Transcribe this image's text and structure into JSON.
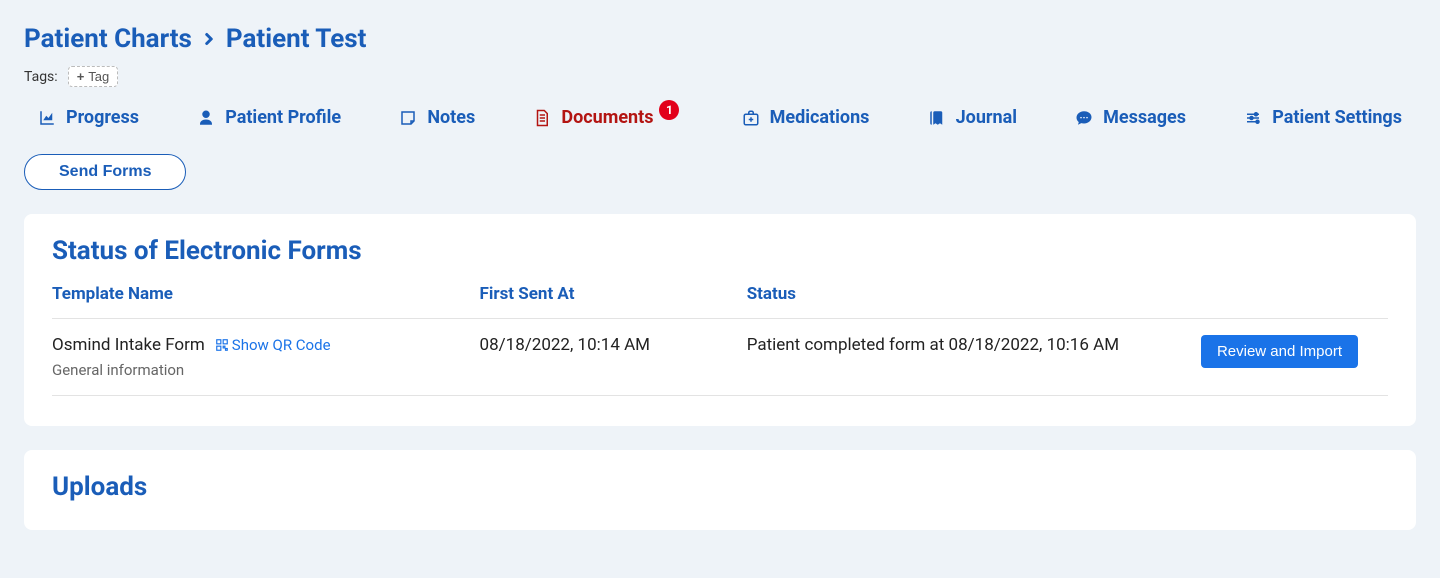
{
  "breadcrumb": {
    "root": "Patient Charts",
    "current": "Patient Test"
  },
  "tags": {
    "label": "Tags:",
    "add_label": "Tag"
  },
  "tabs": {
    "progress": "Progress",
    "profile": "Patient Profile",
    "notes": "Notes",
    "documents": "Documents",
    "documents_badge": "1",
    "medications": "Medications",
    "journal": "Journal",
    "messages": "Messages",
    "settings": "Patient Settings"
  },
  "actions": {
    "send_forms": "Send Forms"
  },
  "forms_card": {
    "title": "Status of Electronic Forms",
    "headers": {
      "template": "Template Name",
      "first_sent": "First Sent At",
      "status": "Status"
    },
    "rows": [
      {
        "template_name": "Osmind Intake Form",
        "qr_label": "Show QR Code",
        "subtext": "General information",
        "first_sent": "08/18/2022, 10:14 AM",
        "status": "Patient completed form at 08/18/2022, 10:16 AM",
        "action": "Review and Import"
      }
    ]
  },
  "uploads_card": {
    "title": "Uploads"
  }
}
